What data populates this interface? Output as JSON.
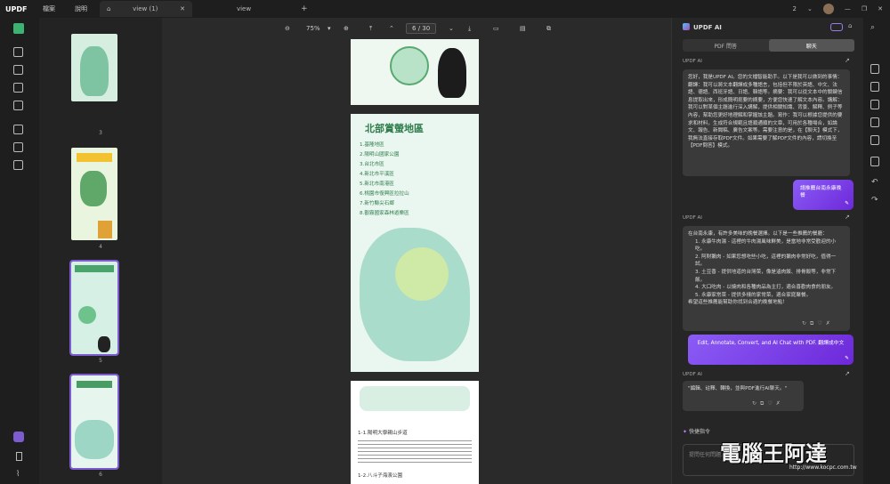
{
  "titlebar": {
    "logo": "UPDF",
    "menu_file": "檔案",
    "menu_help": "說明",
    "tab_active": "view (1)",
    "tab_inactive": "view",
    "add_tab": "+",
    "page_count": "2"
  },
  "toolbar": {
    "zoom": "75%",
    "page_current": "6",
    "page_sep": "/",
    "page_total": "30"
  },
  "thumbnails": [
    {
      "num": "3"
    },
    {
      "num": "4"
    },
    {
      "num": "5"
    },
    {
      "num": "6"
    }
  ],
  "page_north": {
    "title": "北部賞螢地區",
    "items": [
      "1.基隆地區",
      "2.陽明山國家公園",
      "3.台北市區",
      "4.新北市平溪區",
      "5.新北市南港區",
      "6.桃園市復興區拉拉山",
      "7.新竹縣尖石鄉",
      "8.觀霧國家森林遊樂區"
    ]
  },
  "page_bottom": {
    "header": "1-1.陽明大學親山步道",
    "sub": "1-2.八斗子海濱公園"
  },
  "ai": {
    "header": "UPDF AI",
    "tab_pdf": "PDF 問答",
    "tab_chat": "聊天",
    "label": "UPDF AI",
    "intro": "您好，我是UPDF AI。您的文檔智能助手。以下是我可以做到的事情：翻譯：我可以將文本翻譯成多種語言，包括但不限於英語、中文、法語、德語、西班牙語、日語、韓語等。摘要：我可以從文本中的關鍵信息提取出來，形成簡明扼要的摘要，方便您快速了解文本內容。講解：我可以對某個主題進行深入講解，提供相關知識、背景、解釋、例子等內容，幫助您更好地理解和掌握該主題。寫作：我可以根據您提供的要求和材料，生成符合規範且語順通順的文章，可用於各種場合，如論文、報告、新聞稿、廣告文案等。需要注意的是，在【聊天】模式下，我無法直接存取PDF文件。如果需要了解PDF文件的內容，請切換至【PDF問答】模式。",
    "user1": "請推薦台南永康晚餐",
    "resp_intro": "在台南永康，有許多美味的晚餐選擇。以下是一些推薦的餐廳：",
    "resp_items": [
      "1. 永康牛肉湯 - 這裡的牛肉湯風味鮮美，是當地非常受歡迎的小吃。",
      "2. 阿財鵝肉 - 如果您想吃些小吃，這裡的鵝肉非常好吃，值得一試。",
      "3. 土豆香 - 提供地道的台灣菜，像是滷肉飯、排骨飯等，非常下飯。",
      "4. 大口吃肉 - 以燒肉和各種肉品為主打，適合喜歡肉食的朋友。",
      "5. 永康家常菜 - 提供多樣的家常菜，適合家庭聚餐。"
    ],
    "resp_end": "希望這些推薦能幫助你找到合適的晚餐地點！",
    "user2": "Edit, Annotate, Convert, and AI Chat with PDF. 翻譯成中文",
    "translation": "\"編輯、註釋、轉換，並與PDF進行AI聊天。\"",
    "quick": "快捷指令",
    "input_placeholder": "提問任何問題..."
  },
  "watermark": {
    "name": "電腦王阿達",
    "url": "http://www.kocpc.com.tw"
  }
}
